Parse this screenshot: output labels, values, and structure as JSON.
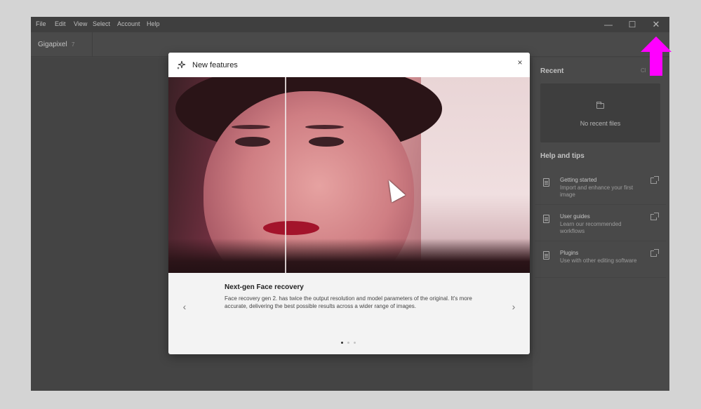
{
  "menubar": {
    "items": [
      "File",
      "Edit",
      "View",
      "Select",
      "Account",
      "Help"
    ],
    "minimize": "—",
    "maximize": "☐",
    "close": "✕"
  },
  "tabs": [
    {
      "label": "Gigapixel",
      "badge": "7"
    }
  ],
  "sidebar": {
    "recent_heading": "Recent",
    "recent_clear": "Cl",
    "recent_empty": "No recent files",
    "help_heading": "Help and tips",
    "help_items": [
      {
        "title": "Getting started",
        "desc": "Import and enhance your first image"
      },
      {
        "title": "User guides",
        "desc": "Learn our recommended workflows"
      },
      {
        "title": "Plugins",
        "desc": "Use with other editing software"
      }
    ]
  },
  "modal": {
    "title": "New features",
    "close": "×",
    "feature_title": "Next-gen Face recovery",
    "feature_desc": "Face recovery gen 2. has twice the output resolution and model parameters of the original. It's more accurate, delivering the best possible results across a wider range of images.",
    "prev": "‹",
    "next": "›",
    "page_count": 3,
    "active_page": 1
  },
  "colors": {
    "annotation_arrow": "#ff00ff"
  }
}
